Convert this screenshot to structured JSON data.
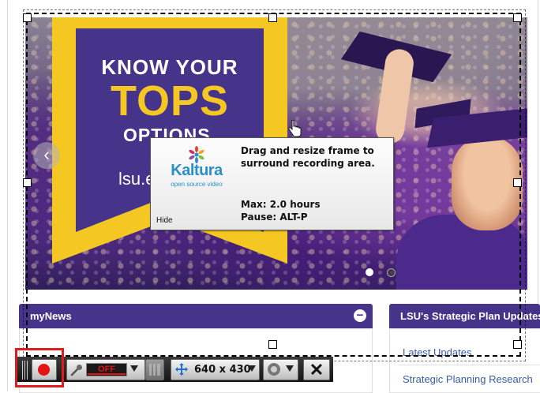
{
  "banner": {
    "line1": "KNOW YOUR",
    "line2": "TOPS",
    "line3": "OPTIONS.",
    "url": "lsu.edu/tops"
  },
  "carousel": {
    "prev_glyph": "‹"
  },
  "panels": {
    "mynews": {
      "title": "myNews",
      "collapse_glyph": "−"
    },
    "strategic": {
      "title": "LSU's Strategic Plan Updates",
      "links": [
        "Latest Updates",
        "Strategic Planning Research"
      ]
    }
  },
  "tooltip": {
    "logo_word": "Kaltura",
    "logo_sub": "open source video",
    "instruction": "Drag and resize frame to surround recording area.",
    "max": "Max: 2.0 hours",
    "pause": "Pause: ALT-P",
    "hide": "Hide"
  },
  "toolbar": {
    "mic_state": "OFF",
    "size": "640 x 430",
    "close_glyph": "✕"
  },
  "colors": {
    "lsu_purple": "#46348a",
    "lsu_gold": "#f5c722",
    "record_red": "#e41414",
    "highlight_red": "#e01b1b"
  },
  "icons": [
    "record-icon",
    "mic-icon",
    "level-meter-icon",
    "expand-icon",
    "webcam-icon",
    "close-icon",
    "cursor-icon",
    "chevron-left-icon"
  ]
}
